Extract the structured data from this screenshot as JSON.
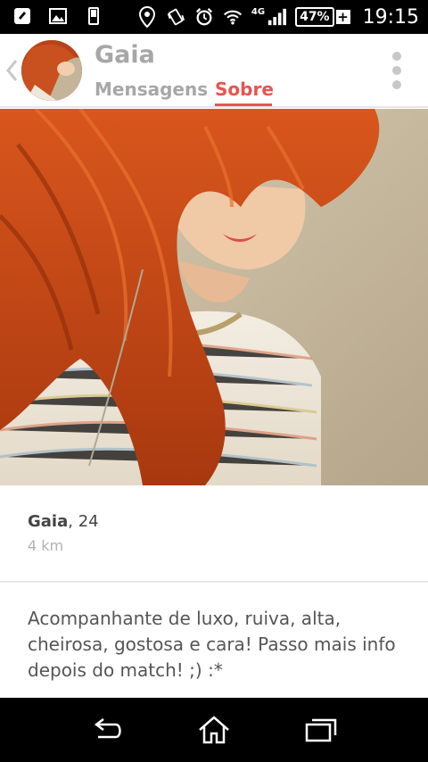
{
  "status_bar": {
    "network_label": "4G",
    "battery_percent": "47%",
    "battery_charging": "+",
    "time": "19:15",
    "icons": [
      "chat-app-icon",
      "gallery-icon",
      "phone-icon",
      "location-icon",
      "vibrate-icon",
      "alarm-icon",
      "wifi-icon",
      "signal-icon"
    ]
  },
  "header": {
    "name": "Gaia",
    "tabs": [
      {
        "label": "Mensagens",
        "active": false
      },
      {
        "label": "Sobre",
        "active": true
      }
    ],
    "accent_color": "#e65550"
  },
  "profile": {
    "name": "Gaia",
    "age_text": ", 24",
    "distance": "4 km",
    "bio": "Acompanhante de luxo, ruiva, alta, cheirosa, gostosa e cara! Passo mais info depois do match! ;) :*"
  },
  "nav_bar": {
    "buttons": [
      "back-icon",
      "home-icon",
      "recent-apps-icon"
    ]
  }
}
